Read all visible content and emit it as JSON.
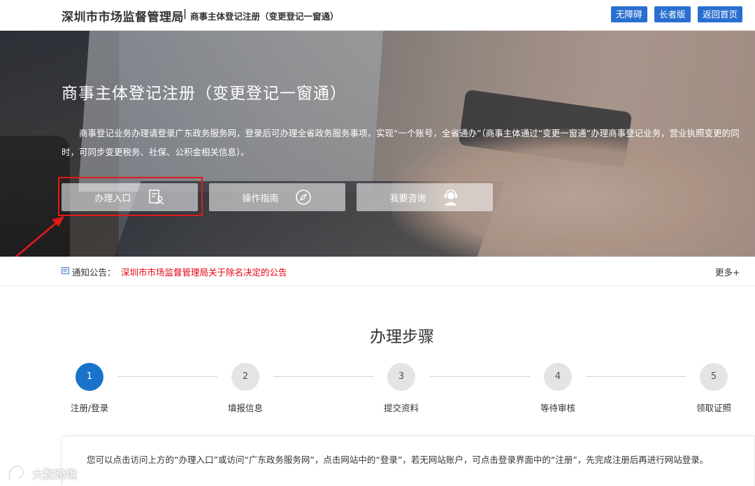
{
  "header": {
    "brand": "深圳市市场监督管理局",
    "separator": "|",
    "subtitle": "商事主体登记注册（变更登记一窗通）",
    "buttons": [
      "无障碍",
      "长者版",
      "返回首页"
    ]
  },
  "hero": {
    "title": "商事主体登记注册（变更登记一窗通）",
    "description": "商事登记业务办理请登录广东政务服务网，登录后可办理全省政务服务事项，实现“一个账号，全省通办”（商事主体通过“变更一窗通”办理商事登记业务，营业执照变更的同时，可同步变更税务、社保、公积金相关信息）。",
    "buttons": [
      {
        "label": "办理入口",
        "icon": "document-user-icon"
      },
      {
        "label": "操作指南",
        "icon": "compass-icon"
      },
      {
        "label": "我要咨询",
        "icon": "customer-service-icon"
      }
    ]
  },
  "notice": {
    "label": "通知公告：",
    "link": "深圳市市场监督管理局关于除名决定的公告",
    "more": "更多+"
  },
  "steps": {
    "title": "办理步骤",
    "items": [
      {
        "number": "1",
        "label": "注册/登录",
        "active": true
      },
      {
        "number": "2",
        "label": "填报信息",
        "active": false
      },
      {
        "number": "3",
        "label": "提交资料",
        "active": false
      },
      {
        "number": "4",
        "label": "等待审核",
        "active": false
      },
      {
        "number": "5",
        "label": "领取证照",
        "active": false
      }
    ]
  },
  "info": {
    "text": "您可以点击访问上方的“办理入口”或访问“广东政务服务网”，点击网站中的“登录”，若无网站账户，可点击登录界面中的“注册”，先完成注册后再进行网站登录。"
  },
  "watermark": {
    "text": "大数跨境"
  },
  "colors": {
    "primary": "#2a6fd0",
    "step_active": "#1a73c9",
    "notice_link": "#e60012",
    "highlight": "#e11a1a"
  }
}
